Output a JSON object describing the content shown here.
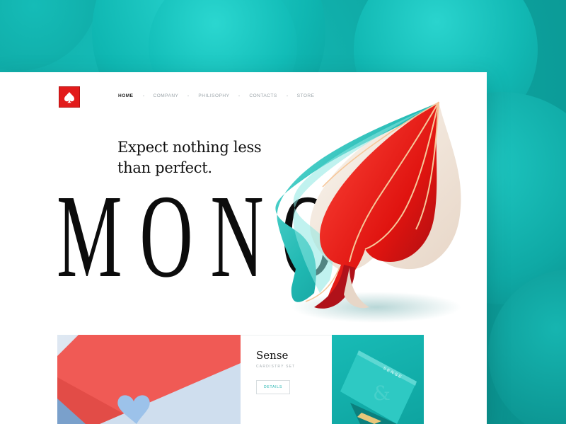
{
  "colors": {
    "accent": "#e21b1b",
    "teal": "#12b3ae",
    "text": "#111111"
  },
  "nav": {
    "items": [
      {
        "label": "HOME",
        "active": true
      },
      {
        "label": "COMPANY"
      },
      {
        "label": "PHILISOPHY"
      },
      {
        "label": "CONTACTS"
      },
      {
        "label": "STORE"
      }
    ]
  },
  "logo": {
    "icon": "spade-icon"
  },
  "hero": {
    "tagline_line1": "Expect nothing less",
    "tagline_line2": "than perfect.",
    "brand": "MONO"
  },
  "products": {
    "title": "Sense",
    "subtitle": "CARDISTRY SET",
    "button": "DETAILS",
    "box_text": "SENSE"
  }
}
